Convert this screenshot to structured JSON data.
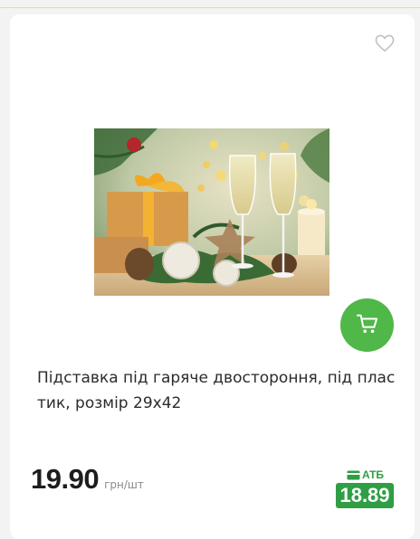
{
  "product": {
    "title": "Підставка під гаряче двостороння, під плас тик, розмір 29х42",
    "price": "19.90",
    "unit": "грн/шт",
    "promo_label": "АТБ",
    "promo_price": "18.89",
    "image_alt": "festive-champagne-glasses-photo"
  },
  "icons": {
    "favorite": "heart-outline-icon",
    "cart": "shopping-cart-icon",
    "card": "card-icon"
  },
  "colors": {
    "accent_green": "#4fb848",
    "promo_green": "#2f9e44"
  }
}
